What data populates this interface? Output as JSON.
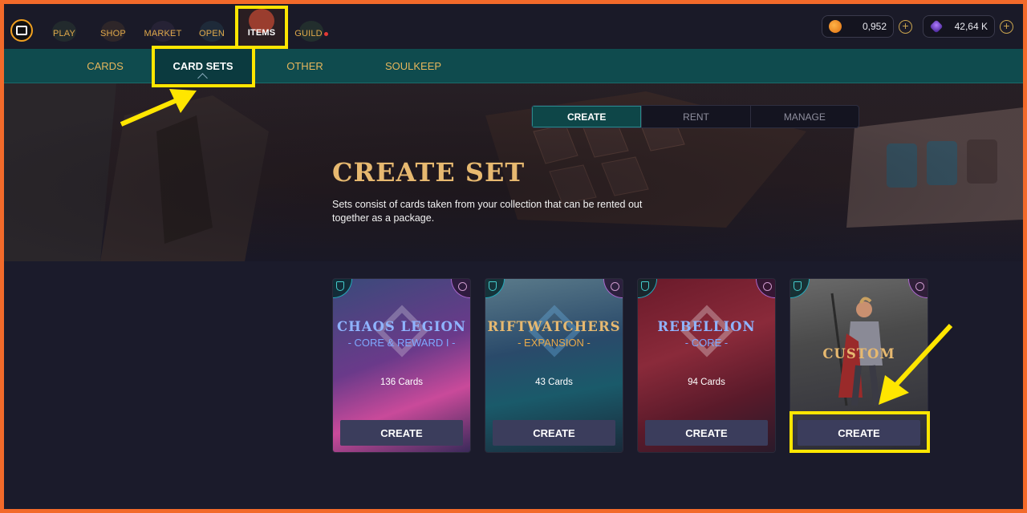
{
  "topnav": {
    "items": [
      {
        "label": "PLAY"
      },
      {
        "label": "SHOP"
      },
      {
        "label": "MARKET"
      },
      {
        "label": "OPEN"
      },
      {
        "label": "ITEMS"
      },
      {
        "label": "GUILD"
      }
    ],
    "currency_1": {
      "value": "0,952",
      "icon": "orange-coin-icon"
    },
    "currency_2": {
      "value": "42,64 K",
      "icon": "purple-crystal-icon"
    },
    "plus_label": "+"
  },
  "subnav": {
    "tabs": [
      {
        "label": "CARDS"
      },
      {
        "label": "CARD SETS"
      },
      {
        "label": "OTHER"
      },
      {
        "label": "SOULKEEP"
      }
    ],
    "active": "CARD SETS"
  },
  "hero": {
    "segments": [
      {
        "label": "CREATE"
      },
      {
        "label": "RENT"
      },
      {
        "label": "MANAGE"
      }
    ],
    "active_segment": "CREATE",
    "title": "CREATE SET",
    "description": "Sets consist of cards taken from your collection that can be rented out together as a package."
  },
  "cards": [
    {
      "title": "CHAOS LEGION",
      "subtitle": "- CORE & REWARD I -",
      "count": "136 Cards",
      "button": "CREATE"
    },
    {
      "title": "RIFTWATCHERS",
      "subtitle": "- EXPANSION -",
      "count": "43 Cards",
      "button": "CREATE"
    },
    {
      "title": "REBELLION",
      "subtitle": "- CORE -",
      "count": "94 Cards",
      "button": "CREATE"
    },
    {
      "title": "CUSTOM",
      "subtitle": "",
      "count": "",
      "button": "CREATE"
    }
  ],
  "colors": {
    "accent_gold": "#e7b970",
    "teal": "#0f4b4e",
    "highlight_yellow": "#ffe600",
    "border_orange": "#f26a2a"
  }
}
